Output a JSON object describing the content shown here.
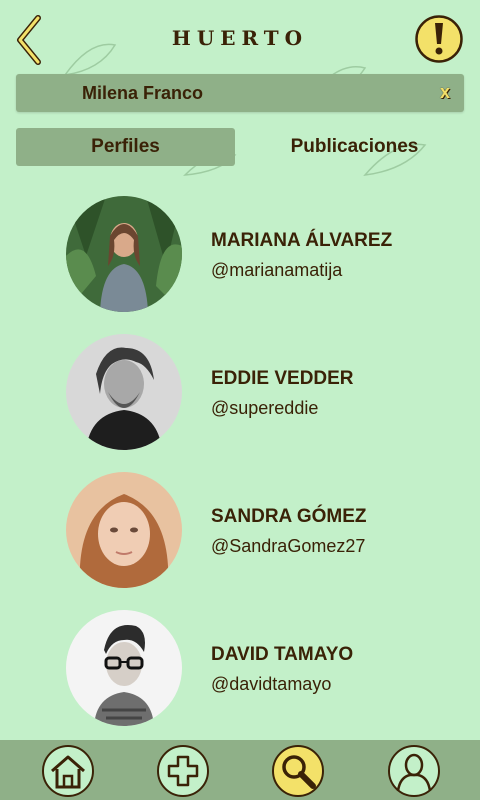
{
  "header": {
    "title": "HUERTO",
    "back_icon": "chevron-left-icon",
    "alert_icon": "exclamation-icon"
  },
  "search": {
    "value": "Milena Franco",
    "clear_label": "x"
  },
  "tabs": [
    {
      "label": "Perfiles",
      "active": true
    },
    {
      "label": "Publicaciones",
      "active": false
    }
  ],
  "profiles": [
    {
      "name": "MARIANA ÁLVAREZ",
      "handle": "@marianamatija"
    },
    {
      "name": "EDDIE VEDDER",
      "handle": "@supereddie"
    },
    {
      "name": "SANDRA GÓMEZ",
      "handle": "@SandraGomez27"
    },
    {
      "name": "DAVID TAMAYO",
      "handle": "@davidtamayo"
    }
  ],
  "bottom_nav": [
    {
      "icon": "home-icon",
      "active": false
    },
    {
      "icon": "plus-icon",
      "active": false
    },
    {
      "icon": "search-icon",
      "active": true
    },
    {
      "icon": "user-icon",
      "active": false
    }
  ],
  "colors": {
    "background": "#c3f0c9",
    "panel": "#8fb088",
    "accent": "#f3e169",
    "text": "#3a2207"
  }
}
